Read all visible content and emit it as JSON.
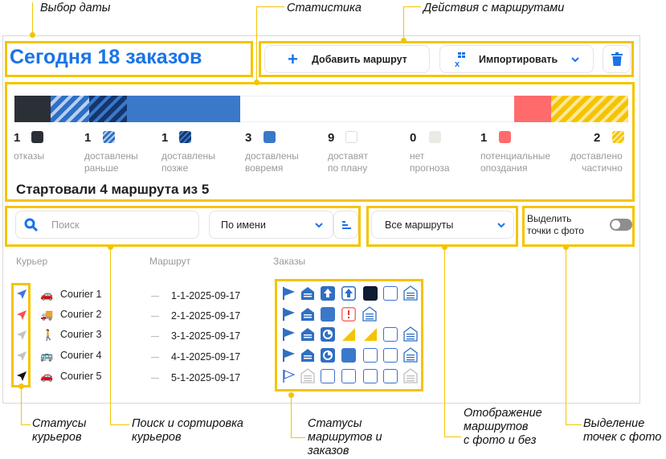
{
  "annotations": {
    "date": "Выбор даты",
    "stats": "Статистика",
    "route_actions": "Действия с маршрутами",
    "courier_statuses": "Статусы\nкурьеров",
    "search_sort": "Поиск и сортировка\nкурьеров",
    "route_statuses": "Статусы\nмаршрутов и\nзаказов",
    "photo_display": "Отображение\nмаршрутов\nс фото и без",
    "photo_points": "Выделение\nточек с фото"
  },
  "header": {
    "title": "Сегодня 18 заказов",
    "add_route": "Добавить маршрут",
    "import": "Импортировать"
  },
  "stats": [
    {
      "count": "1",
      "label": "отказы"
    },
    {
      "count": "1",
      "label": "доставлены\nраньше"
    },
    {
      "count": "1",
      "label": "доставлены\nпозже"
    },
    {
      "count": "3",
      "label": "доставлены\nвовремя"
    },
    {
      "count": "9",
      "label": "доставят\nпо плану"
    },
    {
      "count": "0",
      "label": "нет\nпрогноза"
    },
    {
      "count": "1",
      "label": "потенциальные\nопоздания"
    },
    {
      "count": "2",
      "label": "доставлено\nчастично"
    }
  ],
  "started": "Стартовали 4 маршрута из 5",
  "filters": {
    "search_placeholder": "Поиск",
    "sort": "По имени",
    "routes": "Все маршруты",
    "highlight_photo": "Выделить\nточки с фото"
  },
  "table": {
    "columns": [
      "Курьер",
      "Маршрут",
      "Заказы"
    ],
    "rows": [
      {
        "courier": "Courier 1",
        "route": "1-1-2025-09-17",
        "status_color": "#3a78e0",
        "vehicle": "car"
      },
      {
        "courier": "Courier 2",
        "route": "2-1-2025-09-17",
        "status_color": "#ff4d4d",
        "vehicle": "truck"
      },
      {
        "courier": "Courier 3",
        "route": "3-1-2025-09-17",
        "status_color": "#c4c4c4",
        "vehicle": "walk"
      },
      {
        "courier": "Courier 4",
        "route": "4-1-2025-09-17",
        "status_color": "#c4c4c4",
        "vehicle": "bus"
      },
      {
        "courier": "Courier 5",
        "route": "5-1-2025-09-17",
        "status_color": "#111111",
        "vehicle": "car"
      }
    ]
  },
  "colors": {
    "accent": "#1a73e8",
    "highlight": "#f4c400",
    "red": "#ff6b6b",
    "blue": "#3a78c9",
    "dark": "#2b2f36"
  }
}
